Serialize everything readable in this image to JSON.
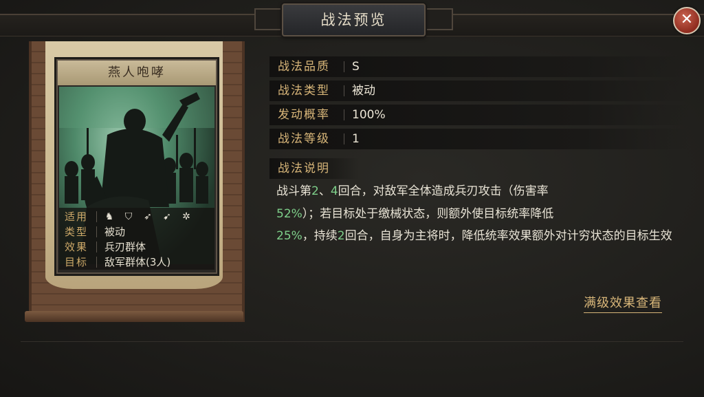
{
  "header": {
    "title": "战法预览",
    "close_symbol": "✕"
  },
  "card": {
    "name": "燕人咆哮",
    "rows": [
      {
        "key": "适用",
        "units": [
          {
            "icon": "cavalry-icon",
            "glyph": "♞"
          },
          {
            "icon": "shield-icon",
            "glyph": "⛉"
          },
          {
            "icon": "bow-icon",
            "glyph": "➶"
          },
          {
            "icon": "spear-icon",
            "glyph": "➹"
          },
          {
            "icon": "chariot-wheel-icon",
            "glyph": "✲"
          }
        ]
      },
      {
        "key": "类型",
        "value": "被动"
      },
      {
        "key": "效果",
        "value": "兵刃群体"
      },
      {
        "key": "目标",
        "value": "敌军群体(3人)"
      }
    ]
  },
  "stats": [
    {
      "label": "战法品质",
      "value": "S"
    },
    {
      "label": "战法类型",
      "value": "被动"
    },
    {
      "label": "发动概率",
      "value": "100%"
    },
    {
      "label": "战法等级",
      "value": "1"
    }
  ],
  "description": {
    "heading": "战法说明",
    "p1": "战斗第",
    "n1": "2",
    "p2": "、",
    "n2": "4",
    "p3": "回合，对敌军全体造成兵刃攻击（伤害率",
    "n3": "52%",
    "p4": "）；若目标处于缴械状态，则额外使目标统率降低",
    "n4": "25%",
    "p5": "，持续",
    "n5": "2",
    "p6": "回合，自身为主将时，降低统率效果额外对计穷状态的目标生效"
  },
  "full_level_link": "满级效果查看",
  "colors": {
    "accent_gold": "#d8b679",
    "highlight_green": "#7ecf8a",
    "close_red": "#a8392a"
  }
}
